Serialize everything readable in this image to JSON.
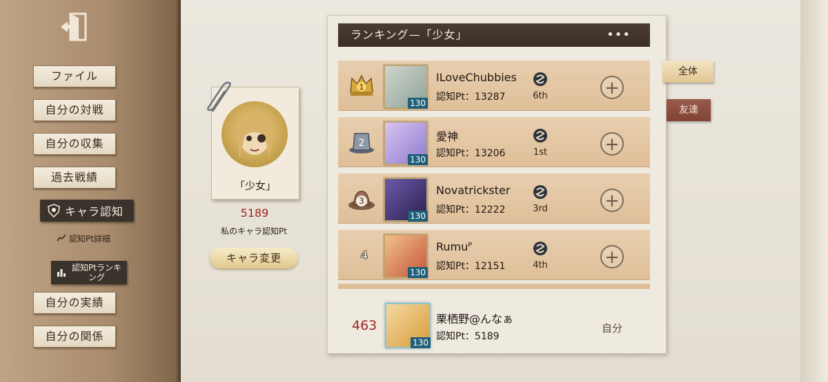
{
  "sidebar": {
    "items": [
      {
        "label": "ファイル"
      },
      {
        "label": "自分の対戦"
      },
      {
        "label": "自分の収集"
      },
      {
        "label": "過去戦績"
      }
    ],
    "active": {
      "label": "キャラ認知"
    },
    "sub_item": {
      "label": "認知Pt詳細"
    },
    "sub_active": {
      "label": "認知Ptランキング"
    },
    "bottom_items": [
      {
        "label": "自分の実績"
      },
      {
        "label": "自分の関係"
      }
    ]
  },
  "profile": {
    "character_name": "「少女」",
    "my_points": "5189",
    "my_points_label": "私のキャラ認知Pt",
    "change_button": "キャラ変更"
  },
  "ranking": {
    "title": "ランキング—「少女」",
    "more": "•••",
    "rows": [
      {
        "rank": "1",
        "name": "ILoveChubbies",
        "points": "認知Pt：13287",
        "level": "130",
        "tier": "6th"
      },
      {
        "rank": "2",
        "name": "愛神",
        "points": "認知Pt：13206",
        "level": "130",
        "tier": "1st"
      },
      {
        "rank": "3",
        "name": "Novatrickster",
        "points": "認知Pt：12222",
        "level": "130",
        "tier": "3rd"
      },
      {
        "rank": "4",
        "name": "Rumuᴾ",
        "points": "認知Pt：12151",
        "level": "130",
        "tier": "4th"
      }
    ],
    "me": {
      "rank": "463",
      "name": "栗栖野@んなぁ",
      "points": "認知Pt：5189",
      "level": "130",
      "self_label": "自分"
    }
  },
  "tabs": {
    "all": "全体",
    "friends": "友達"
  },
  "colors": {
    "accent_red": "#a02622",
    "header_dark": "#3a2e27",
    "row_tan": "#dfbf99"
  }
}
